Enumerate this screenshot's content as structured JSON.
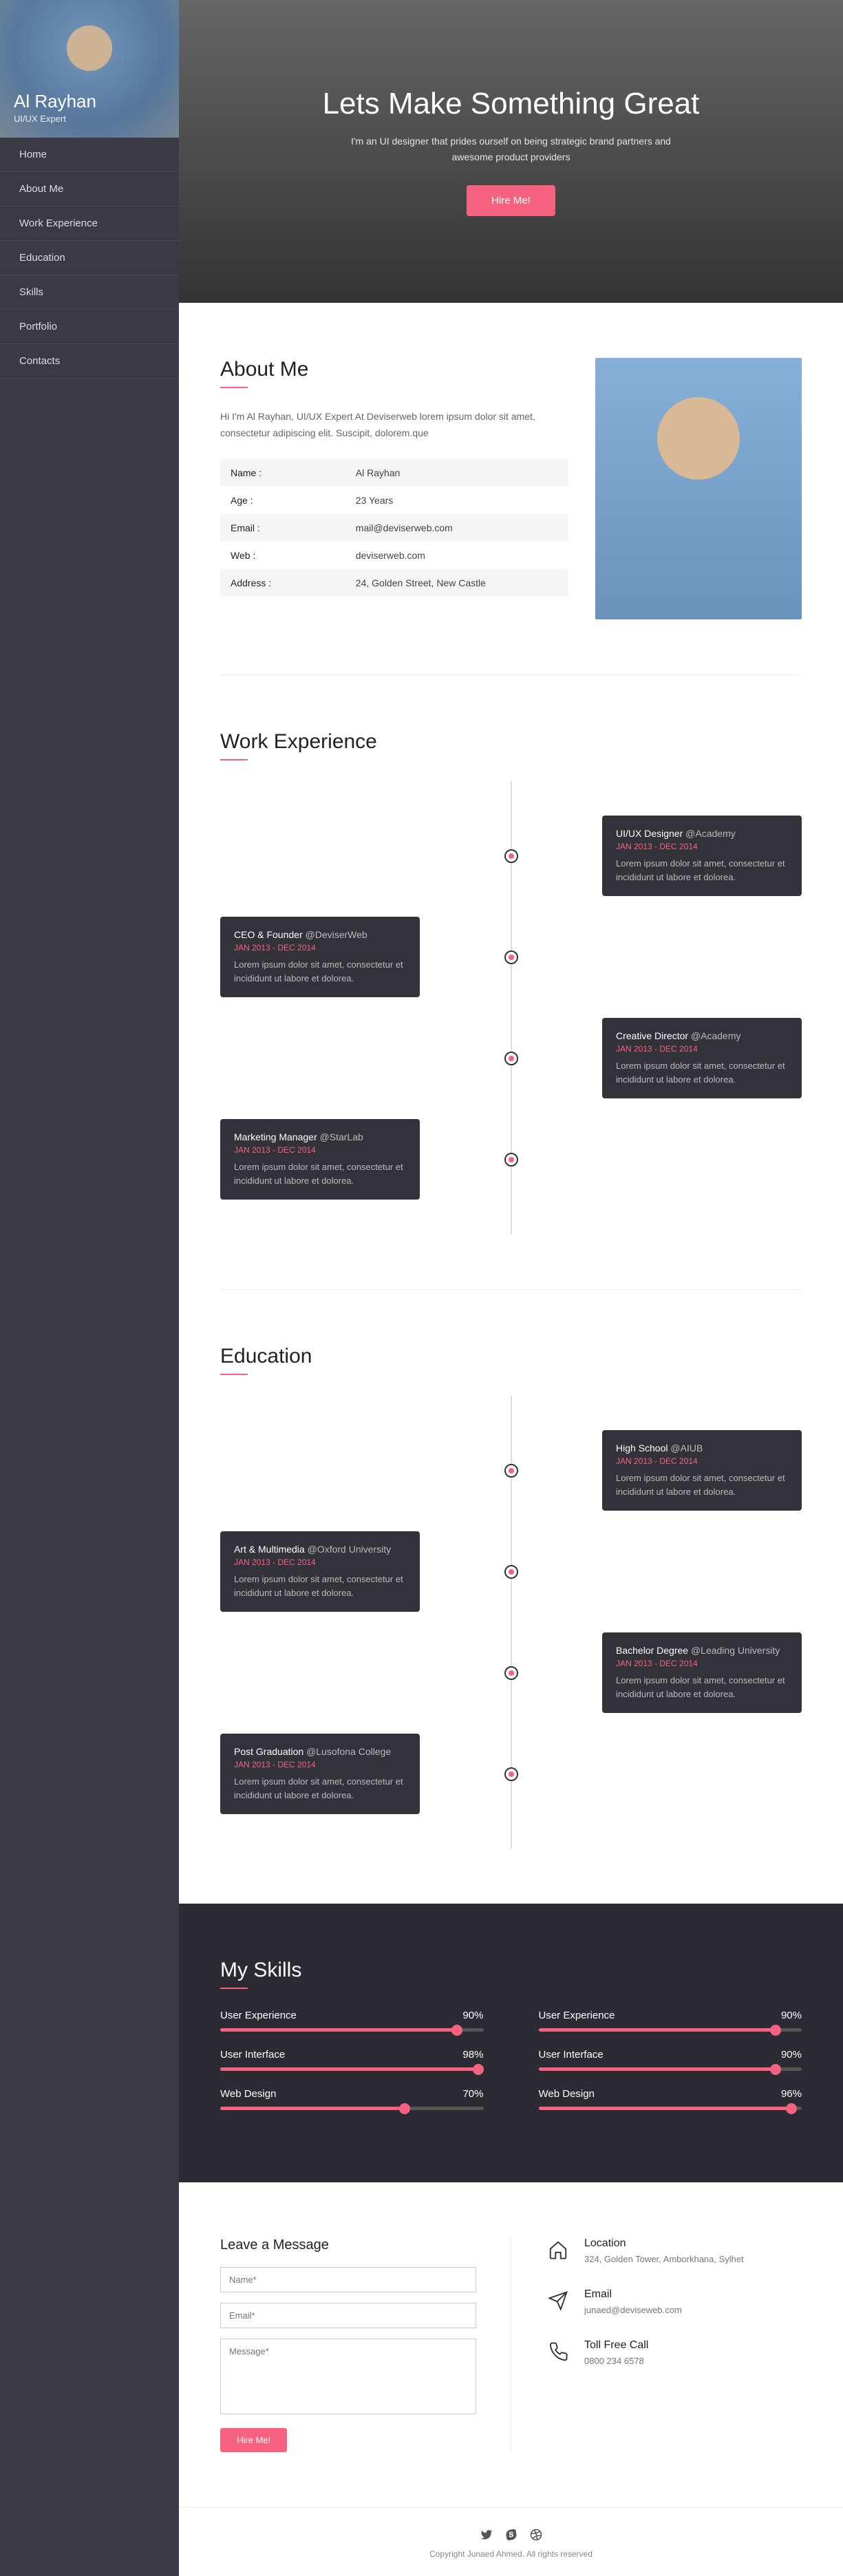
{
  "sidebar": {
    "name": "Al Rayhan",
    "role": "UI/UX Expert",
    "nav": [
      "Home",
      "About Me",
      "Work Experience",
      "Education",
      "Skills",
      "Portfolio",
      "Contacts"
    ]
  },
  "hero": {
    "title": "Lets Make Something Great",
    "sub": "I'm an UI designer that prides ourself on being strategic brand partners and awesome product providers",
    "btn": "Hire Me!"
  },
  "about": {
    "title": "About Me",
    "intro": "Hi I'm Al Rayhan, UI/UX Expert At Deviserweb lorem ipsum dolor sit amet, consectetur adipiscing elit. Suscipit, dolorem.que",
    "rows": [
      {
        "k": "Name :",
        "v": "Al Rayhan"
      },
      {
        "k": "Age :",
        "v": "23 Years"
      },
      {
        "k": "Email :",
        "v": "mail@deviserweb.com"
      },
      {
        "k": "Web :",
        "v": "deviserweb.com"
      },
      {
        "k": "Address :",
        "v": "24, Golden Street, New Castle"
      }
    ]
  },
  "work": {
    "title": "Work Experience",
    "items": [
      {
        "side": "right",
        "title": "UI/UX Designer",
        "at": "@Academy",
        "date": "JAN 2013 - DEC 2014",
        "body": "Lorem ipsum dolor sit amet, consectetur et incididunt ut labore et dolorea."
      },
      {
        "side": "left",
        "title": "CEO & Founder",
        "at": "@DeviserWeb",
        "date": "JAN 2013 - DEC 2014",
        "body": "Lorem ipsum dolor sit amet, consectetur et incididunt ut labore et dolorea."
      },
      {
        "side": "right",
        "title": "Creative Director",
        "at": "@Academy",
        "date": "JAN 2013 - DEC 2014",
        "body": "Lorem ipsum dolor sit amet, consectetur et incididunt ut labore et dolorea."
      },
      {
        "side": "left",
        "title": "Marketing Manager",
        "at": "@StarLab",
        "date": "JAN 2013 - DEC 2014",
        "body": "Lorem ipsum dolor sit amet, consectetur et incididunt ut labore et dolorea."
      }
    ]
  },
  "edu": {
    "title": "Education",
    "items": [
      {
        "side": "right",
        "title": "High School",
        "at": "@AIUB",
        "date": "JAN 2013 - DEC 2014",
        "body": "Lorem ipsum dolor sit amet, consectetur et incididunt ut labore et dolorea."
      },
      {
        "side": "left",
        "title": "Art & Multimedia",
        "at": "@Oxford University",
        "date": "JAN 2013 - DEC 2014",
        "body": "Lorem ipsum dolor sit amet, consectetur et incididunt ut labore et dolorea."
      },
      {
        "side": "right",
        "title": "Bachelor Degree",
        "at": "@Leading University",
        "date": "JAN 2013 - DEC 2014",
        "body": "Lorem ipsum dolor sit amet, consectetur et incididunt ut labore et dolorea."
      },
      {
        "side": "left",
        "title": "Post Graduation",
        "at": "@Lusofona College",
        "date": "JAN 2013 - DEC 2014",
        "body": "Lorem ipsum dolor sit amet, consectetur et incididunt ut labore et dolorea."
      }
    ]
  },
  "skills": {
    "title": "My Skills",
    "left": [
      {
        "name": "User Experience",
        "pct": 90
      },
      {
        "name": "User Interface",
        "pct": 98
      },
      {
        "name": "Web Design",
        "pct": 70
      }
    ],
    "right": [
      {
        "name": "User Experience",
        "pct": 90
      },
      {
        "name": "User Interface",
        "pct": 90
      },
      {
        "name": "Web Design",
        "pct": 96
      }
    ]
  },
  "contact": {
    "title": "Leave a Message",
    "ph_name": "Name*",
    "ph_email": "Email*",
    "ph_msg": "Message*",
    "btn": "Hire Me!",
    "info": [
      {
        "icon": "home",
        "title": "Location",
        "text": "324, Golden Tower, Amborkhana, Sylhet"
      },
      {
        "icon": "send",
        "title": "Email",
        "text": "junaed@deviseweb.com"
      },
      {
        "icon": "phone",
        "title": "Toll Free Call",
        "text": "0800 234 6578"
      }
    ]
  },
  "footer": {
    "copy": "Copyright Junaed Ahmed. All rights reserved"
  }
}
